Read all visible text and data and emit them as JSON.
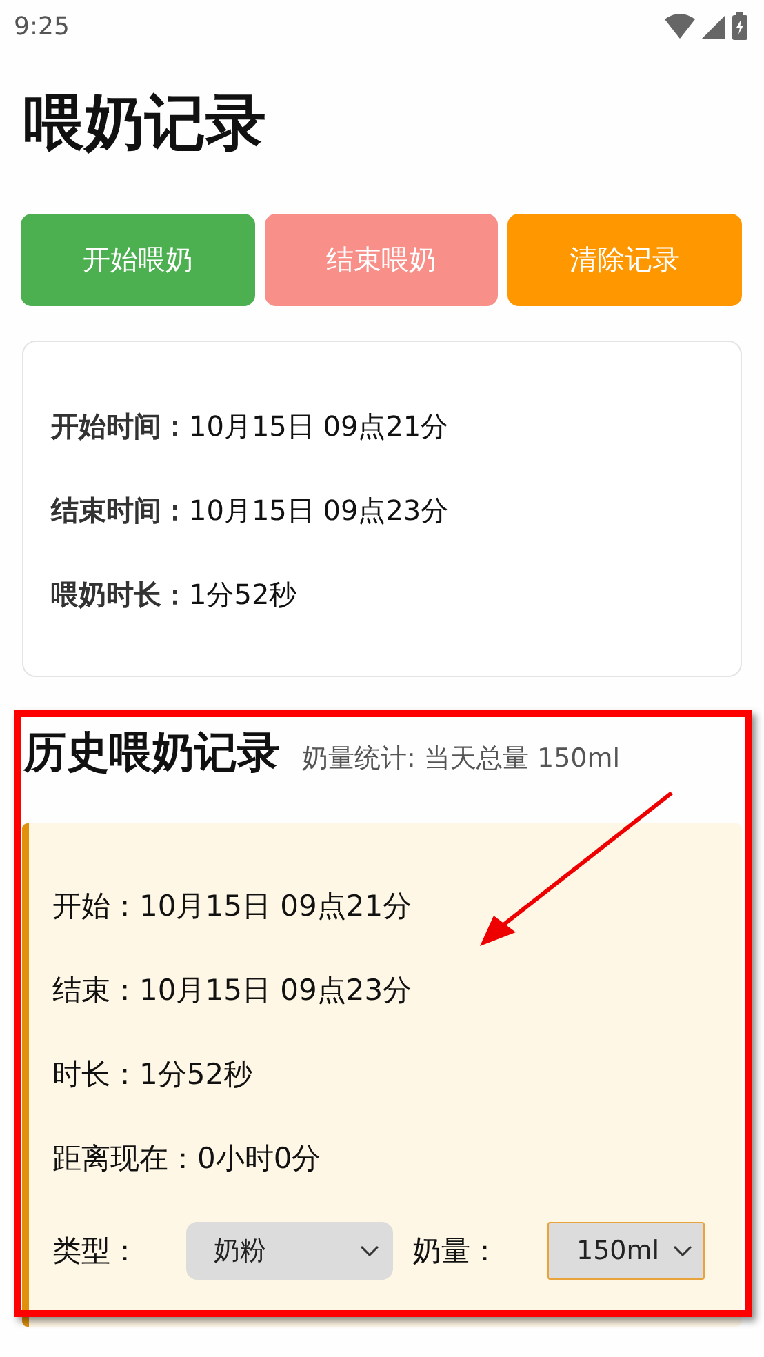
{
  "status_bar": {
    "time": "9:25"
  },
  "title": "喂奶记录",
  "buttons": [
    {
      "label": "开始喂奶",
      "kind": "start"
    },
    {
      "label": "结束喂奶",
      "kind": "end"
    },
    {
      "label": "清除记录",
      "kind": "clear"
    }
  ],
  "current": [
    {
      "label": "开始时间：",
      "value": "10月15日 09点21分"
    },
    {
      "label": "结束时间：",
      "value": "10月15日 09点23分"
    },
    {
      "label": "喂奶时长：",
      "value": "1分52秒"
    }
  ],
  "history": {
    "title": "历史喂奶记录",
    "summary": "奶量统计: 当天总量 150ml",
    "records": [
      {
        "lines": [
          {
            "label": "开始：",
            "value": "10月15日 09点21分"
          },
          {
            "label": "结束：",
            "value": "10月15日 09点23分"
          },
          {
            "label": "时长：",
            "value": "1分52秒"
          },
          {
            "label": "距离现在：",
            "value": "0小时0分"
          }
        ],
        "selects": [
          {
            "label": "类型：",
            "value": "奶粉",
            "kind": "rounded",
            "focused": false
          },
          {
            "label": "奶量：",
            "value": "150ml",
            "kind": "square",
            "focused": true
          }
        ]
      }
    ]
  }
}
